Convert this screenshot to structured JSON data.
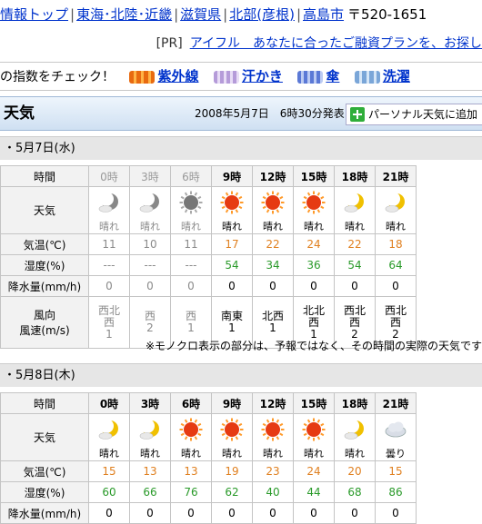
{
  "breadcrumb": {
    "items": [
      "情報トップ",
      "東海･北陸･近畿",
      "滋賀県",
      "北部(彦根)",
      "高島市"
    ],
    "zip": "〒520-1651"
  },
  "pr": {
    "tag": "[PR]",
    "link": "アイフル　あなたに合ったご融資プランを、お探し"
  },
  "indices": {
    "lead": "の指数をチェック！",
    "items": [
      {
        "label": "紫外線",
        "icon": "uv-icon"
      },
      {
        "label": "汗かき",
        "icon": "sweat-icon"
      },
      {
        "label": "傘",
        "icon": "umbrella-icon"
      },
      {
        "label": "洗濯",
        "icon": "laundry-icon"
      }
    ]
  },
  "header": {
    "title": "天気",
    "issued": "2008年5月7日　6時30分発表",
    "personal_button": "パーソナル天気に追加"
  },
  "days": [
    {
      "date": "・5月7日(水)",
      "labels": {
        "time": "時間",
        "weather": "天気",
        "temp": "気温(℃)",
        "humidity": "湿度(%)",
        "rain": "降水量(mm/h)",
        "wind": "風向\n風速(m/s)"
      },
      "cols": [
        {
          "time": "0時",
          "mono": true,
          "icon": "moon-cloud-icon",
          "cond": "晴れ",
          "temp": "11",
          "hum": "---",
          "rain": "0",
          "wdir": "西北\n西",
          "wspd": "1"
        },
        {
          "time": "3時",
          "mono": true,
          "icon": "moon-cloud-icon",
          "cond": "晴れ",
          "temp": "10",
          "hum": "---",
          "rain": "0",
          "wdir": "西",
          "wspd": "2"
        },
        {
          "time": "6時",
          "mono": true,
          "icon": "sun-icon",
          "cond": "晴れ",
          "temp": "11",
          "hum": "---",
          "rain": "0",
          "wdir": "西",
          "wspd": "1"
        },
        {
          "time": "9時",
          "mono": false,
          "icon": "sun-icon",
          "cond": "晴れ",
          "temp": "17",
          "hum": "54",
          "rain": "0",
          "wdir": "南東",
          "wspd": "1"
        },
        {
          "time": "12時",
          "mono": false,
          "icon": "sun-icon",
          "cond": "晴れ",
          "temp": "22",
          "hum": "34",
          "rain": "0",
          "wdir": "北西",
          "wspd": "1"
        },
        {
          "time": "15時",
          "mono": false,
          "icon": "sun-icon",
          "cond": "晴れ",
          "temp": "24",
          "hum": "36",
          "rain": "0",
          "wdir": "北北\n西",
          "wspd": "1"
        },
        {
          "time": "18時",
          "mono": false,
          "icon": "moon-icon",
          "cond": "晴れ",
          "temp": "22",
          "hum": "54",
          "rain": "0",
          "wdir": "西北\n西",
          "wspd": "2"
        },
        {
          "time": "21時",
          "mono": false,
          "icon": "moon-icon",
          "cond": "晴れ",
          "temp": "18",
          "hum": "64",
          "rain": "0",
          "wdir": "西北\n西",
          "wspd": "2"
        }
      ],
      "note": "※モノクロ表示の部分は、予報ではなく、その時間の実際の天気です"
    },
    {
      "date": "・5月8日(木)",
      "labels": {
        "time": "時間",
        "weather": "天気",
        "temp": "気温(℃)",
        "humidity": "湿度(%)",
        "rain": "降水量(mm/h)"
      },
      "cols": [
        {
          "time": "0時",
          "icon": "moon-icon",
          "cond": "晴れ",
          "temp": "15",
          "hum": "60",
          "rain": "0"
        },
        {
          "time": "3時",
          "icon": "moon-icon",
          "cond": "晴れ",
          "temp": "13",
          "hum": "66",
          "rain": "0"
        },
        {
          "time": "6時",
          "icon": "sun-icon",
          "cond": "晴れ",
          "temp": "13",
          "hum": "76",
          "rain": "0"
        },
        {
          "time": "9時",
          "icon": "sun-icon",
          "cond": "晴れ",
          "temp": "19",
          "hum": "62",
          "rain": "0"
        },
        {
          "time": "12時",
          "icon": "sun-icon",
          "cond": "晴れ",
          "temp": "23",
          "hum": "40",
          "rain": "0"
        },
        {
          "time": "15時",
          "icon": "sun-icon",
          "cond": "晴れ",
          "temp": "24",
          "hum": "44",
          "rain": "0"
        },
        {
          "time": "18時",
          "icon": "moon-icon",
          "cond": "晴れ",
          "temp": "20",
          "hum": "68",
          "rain": "0"
        },
        {
          "time": "21時",
          "icon": "cloud-icon",
          "cond": "曇り",
          "temp": "15",
          "hum": "86",
          "rain": "0"
        }
      ]
    }
  ],
  "colors": {
    "temp": "#e08020",
    "humidity": "#2a9a2a",
    "link": "#0033cc",
    "header_bg": "#d8e7f6"
  }
}
